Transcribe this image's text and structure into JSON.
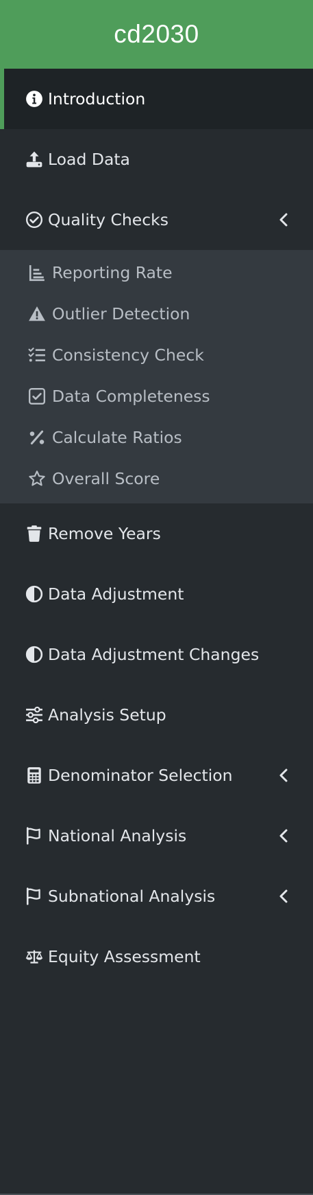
{
  "brand": {
    "title": "cd2030"
  },
  "menu": {
    "introduction": "Introduction",
    "load_data": "Load Data",
    "quality_checks": "Quality Checks",
    "quality_sub": {
      "reporting_rate": "Reporting Rate",
      "outlier_detection": "Outlier Detection",
      "consistency_check": "Consistency Check",
      "data_completeness": "Data Completeness",
      "calculate_ratios": "Calculate Ratios",
      "overall_score": "Overall Score"
    },
    "remove_years": "Remove Years",
    "data_adjustment": "Data Adjustment",
    "data_adjustment_changes": "Data Adjustment Changes",
    "analysis_setup": "Analysis Setup",
    "denominator_selection": "Denominator Selection",
    "national_analysis": "National Analysis",
    "subnational_analysis": "Subnational Analysis",
    "equity_assessment": "Equity Assessment"
  },
  "colors": {
    "brand": "#4f9d5a",
    "sidebar_bg": "#262b2f",
    "submenu_bg": "#343a40",
    "active_bg": "#1e2326"
  }
}
